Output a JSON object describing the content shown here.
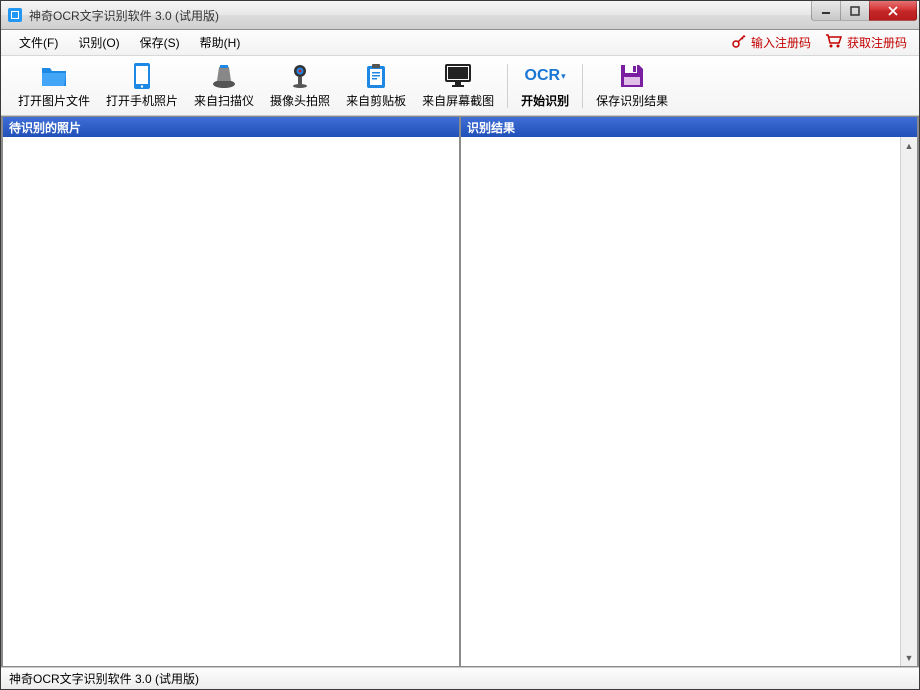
{
  "window": {
    "title": "神奇OCR文字识别软件 3.0 (试用版)"
  },
  "menubar": {
    "items": [
      {
        "label": "文件(F)"
      },
      {
        "label": "识别(O)"
      },
      {
        "label": "保存(S)"
      },
      {
        "label": "帮助(H)"
      }
    ],
    "register_input": "输入注册码",
    "register_get": "获取注册码"
  },
  "toolbar": {
    "open_image": "打开图片文件",
    "open_phone": "打开手机照片",
    "scanner": "来自扫描仪",
    "camera": "摄像头拍照",
    "clipboard": "来自剪贴板",
    "screenshot": "来自屏幕截图",
    "ocr_text": "OCR",
    "start_ocr": "开始识别",
    "save_result": "保存识别结果"
  },
  "panels": {
    "left_title": "待识别的照片",
    "right_title": "识别结果"
  },
  "statusbar": {
    "text": "神奇OCR文字识别软件 3.0 (试用版)"
  }
}
